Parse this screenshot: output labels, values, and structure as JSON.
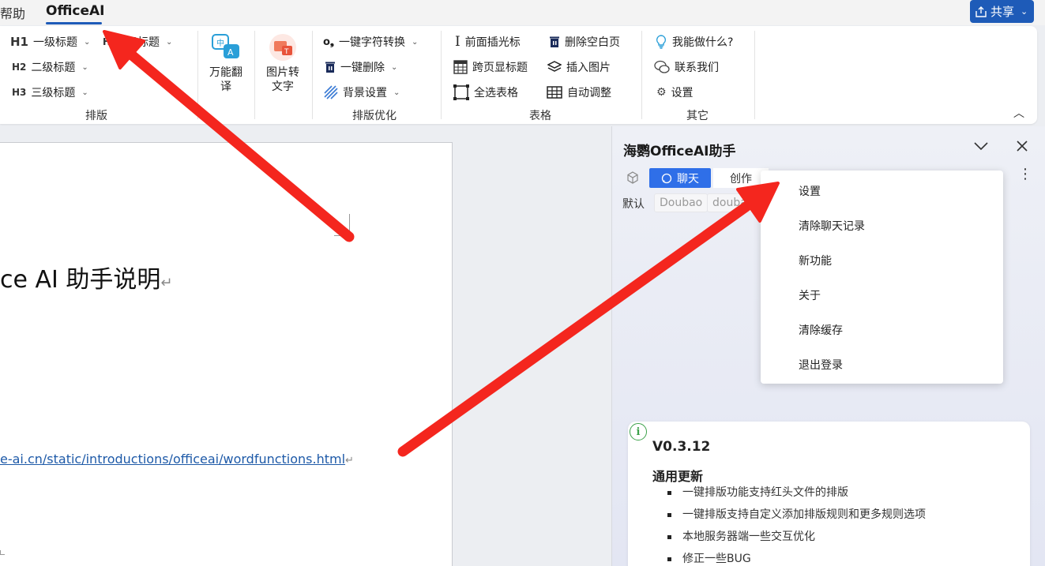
{
  "menubar": {
    "tabs": [
      "帮助",
      "OfficeAI"
    ],
    "share_label": "共享"
  },
  "ribbon": {
    "layout_group": {
      "items": [
        {
          "level": "H1",
          "label": "一级标题"
        },
        {
          "level": "H2",
          "label": "二级标题"
        },
        {
          "level": "H3",
          "label": "三级标题"
        },
        {
          "level": "H",
          "label": "四级标题"
        }
      ],
      "translate_label": "万能翻译",
      "image_to_text_label": "图片转文字",
      "group_label": "排版"
    },
    "optimize_group": {
      "items": [
        "一键字符转换",
        "一键删除",
        "背景设置"
      ],
      "group_label": "排版优化"
    },
    "table_group": {
      "items": [
        "前面插光标",
        "删除空白页",
        "跨页显标题",
        "插入图片",
        "全选表格",
        "自动调整"
      ],
      "group_label": "表格"
    },
    "other_group": {
      "items": [
        "我能做什么?",
        "联系我们",
        "设置"
      ],
      "group_label": "其它"
    }
  },
  "document": {
    "title": "ce AI 助手说明",
    "link": "e-ai.cn/static/introductions/officeai/wordfunctions.html",
    "return_mark": "↵"
  },
  "panel": {
    "title": "海鹦OfficeAI助手",
    "tabs": [
      "聊天",
      "创作"
    ],
    "active_tab": "聊天",
    "model_label": "默认",
    "model_chips": [
      "Doubao",
      "doubao"
    ],
    "update": {
      "version": "V0.3.12",
      "heading": "通用更新",
      "items": [
        "一键排版功能支持红头文件的排版",
        "一键排版支持自定义添加排版规则和更多规则选项",
        "本地服务器端一些交互优化",
        "修正一些BUG"
      ]
    }
  },
  "dropdown": {
    "items": [
      "设置",
      "清除聊天记录",
      "新功能",
      "关于",
      "清除缓存",
      "退出登录"
    ]
  },
  "colors": {
    "accent": "#1e5bb8",
    "chat_tab": "#2f6fe8",
    "arrow": "#f4261e"
  },
  "icons": [
    "share-icon",
    "translate-icon",
    "image-text-icon",
    "cursor-icon",
    "delete-page-icon",
    "table-header-icon",
    "image-stack-icon",
    "select-table-icon",
    "autofit-icon",
    "bulb-icon",
    "wechat-icon",
    "gear-icon",
    "chat-bubble-icon",
    "cube-icon",
    "info-icon",
    "close-icon",
    "chevron-down-icon",
    "more-icon"
  ]
}
